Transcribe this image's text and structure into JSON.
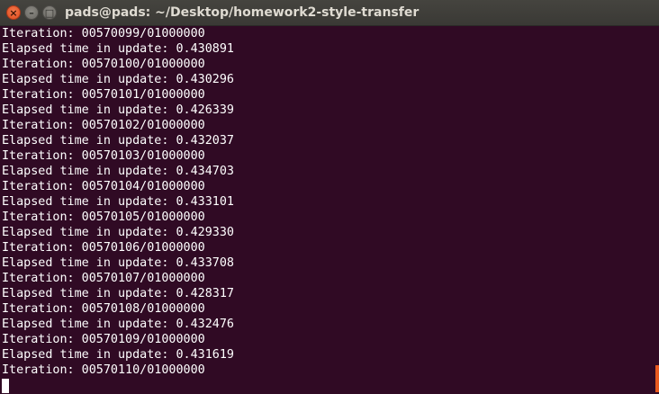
{
  "window": {
    "title": "pads@pads: ~/Desktop/homework2-style-transfer",
    "close_glyph": "×",
    "minimize_glyph": "–",
    "maximize_glyph": "□"
  },
  "terminal": {
    "lines": [
      "Iteration: 00570099/01000000",
      "Elapsed time in update: 0.430891",
      "Iteration: 00570100/01000000",
      "Elapsed time in update: 0.430296",
      "Iteration: 00570101/01000000",
      "Elapsed time in update: 0.426339",
      "Iteration: 00570102/01000000",
      "Elapsed time in update: 0.432037",
      "Iteration: 00570103/01000000",
      "Elapsed time in update: 0.434703",
      "Iteration: 00570104/01000000",
      "Elapsed time in update: 0.433101",
      "Iteration: 00570105/01000000",
      "Elapsed time in update: 0.429330",
      "Iteration: 00570106/01000000",
      "Elapsed time in update: 0.433708",
      "Iteration: 00570107/01000000",
      "Elapsed time in update: 0.428317",
      "Iteration: 00570108/01000000",
      "Elapsed time in update: 0.432476",
      "Iteration: 00570109/01000000",
      "Elapsed time in update: 0.431619",
      "Iteration: 00570110/01000000"
    ]
  },
  "colors": {
    "background": "#300a24",
    "text": "#ffffff",
    "close_button": "#df4a1b",
    "scroll_thumb": "#e85a1f"
  }
}
